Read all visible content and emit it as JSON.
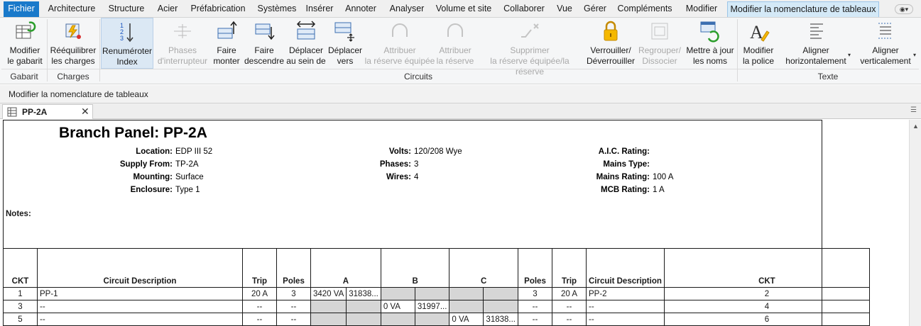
{
  "tabs": [
    "Fichier",
    "Architecture",
    "Structure",
    "Acier",
    "Préfabrication",
    "Systèmes",
    "Insérer",
    "Annoter",
    "Analyser",
    "Volume et site",
    "Collaborer",
    "Vue",
    "Gérer",
    "Compléments",
    "Modifier",
    "Modifier la nomenclature de tableaux"
  ],
  "ribbon": {
    "buttons": [
      {
        "label": "Modifier\nle gabarit",
        "icon": "edit-template-icon"
      },
      {
        "label": "Rééquilibrer\nles charges",
        "icon": "rebalance-loads-icon"
      },
      {
        "label": "Renuméroter\nIndex",
        "icon": "renumber-index-icon"
      },
      {
        "label": "Phases\nd'interrupteur",
        "icon": "switch-phases-icon"
      },
      {
        "label": "Faire\nmonter",
        "icon": "move-up-icon"
      },
      {
        "label": "Faire\ndescendre",
        "icon": "move-down-icon"
      },
      {
        "label": "Déplacer\nau sein de",
        "icon": "move-across-icon"
      },
      {
        "label": "Déplacer\nvers",
        "icon": "move-to-icon"
      },
      {
        "label": "Attribuer\nla réserve équipée",
        "icon": "assign-spare-icon"
      },
      {
        "label": "Attribuer\nla réserve",
        "icon": "assign-space-icon"
      },
      {
        "label": "Supprimer\nla réserve équipée/la réserve",
        "icon": "remove-spare-icon"
      },
      {
        "label": "Verrouiller/\nDéverrouiller",
        "icon": "lock-icon"
      },
      {
        "label": "Regrouper/\nDissocier",
        "icon": "group-icon"
      },
      {
        "label": "Mettre à jour\nles noms",
        "icon": "update-names-icon"
      },
      {
        "label": "Modifier\nla police",
        "icon": "font-icon"
      },
      {
        "label": "Aligner\nhorizontalement",
        "icon": "align-horizontal-icon"
      },
      {
        "label": "Aligner\nverticalement",
        "icon": "align-vertical-icon"
      }
    ],
    "groups": [
      "Gabarit",
      "Charges",
      "Circuits",
      "Texte"
    ]
  },
  "context_label": "Modifier la nomenclature de tableaux",
  "doc_tab": "PP-2A",
  "panel": {
    "title": "Branch Panel: PP-2A",
    "left": [
      {
        "label": "Location:",
        "value": "EDP III 52"
      },
      {
        "label": "Supply From:",
        "value": "TP-2A"
      },
      {
        "label": "Mounting:",
        "value": "Surface"
      },
      {
        "label": "Enclosure:",
        "value": "Type 1"
      }
    ],
    "mid": [
      {
        "label": "Volts:",
        "value": "120/208 Wye"
      },
      {
        "label": "Phases:",
        "value": "3"
      },
      {
        "label": "Wires:",
        "value": "4"
      }
    ],
    "right": [
      {
        "label": "A.I.C. Rating:",
        "value": ""
      },
      {
        "label": "Mains Type:",
        "value": ""
      },
      {
        "label": "Mains Rating:",
        "value": "100 A"
      },
      {
        "label": "MCB Rating:",
        "value": "1 A"
      }
    ],
    "notes_label": "Notes:"
  },
  "table": {
    "headers": [
      "CKT",
      "Circuit Description",
      "Trip",
      "Poles",
      "A",
      "B",
      "C",
      "Poles",
      "Trip",
      "Circuit Description",
      "CKT"
    ],
    "rows": [
      {
        "ckt_l": "1",
        "desc_l": "PP-1",
        "trip_l": "20 A",
        "poles_l": "3",
        "a1": "3420 VA",
        "a2": "31838...",
        "b1": "",
        "b2": "",
        "c1": "",
        "c2": "",
        "poles_r": "3",
        "trip_r": "20 A",
        "desc_r": "PP-2",
        "ckt_r": "2"
      },
      {
        "ckt_l": "3",
        "desc_l": "--",
        "trip_l": "--",
        "poles_l": "--",
        "a1": "",
        "a2": "",
        "b1": "0 VA",
        "b2": "31997...",
        "c1": "",
        "c2": "",
        "poles_r": "--",
        "trip_r": "--",
        "desc_r": "--",
        "ckt_r": "4"
      },
      {
        "ckt_l": "5",
        "desc_l": "--",
        "trip_l": "--",
        "poles_l": "--",
        "a1": "",
        "a2": "",
        "b1": "",
        "b2": "",
        "c1": "0 VA",
        "c2": "31838...",
        "poles_r": "--",
        "trip_r": "--",
        "desc_r": "--",
        "ckt_r": "6"
      }
    ]
  }
}
